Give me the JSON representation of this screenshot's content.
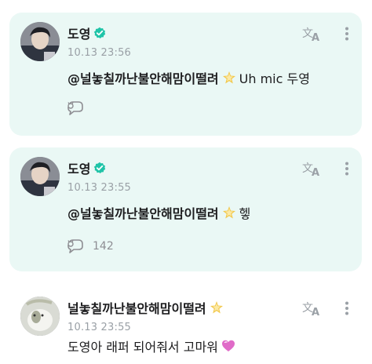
{
  "posts": [
    {
      "author": "도영",
      "time": "10.13 23:56",
      "mention": "@널놓칠까난불안해맘이떨려",
      "text": "Uh mic 두영",
      "reply_count": ""
    },
    {
      "author": "도영",
      "time": "10.13 23:55",
      "mention": "@널놓칠까난불안해맘이떨려",
      "text": "헿",
      "reply_count": "142"
    },
    {
      "author": "널놓칠까난불안해맘이떨려",
      "time": "10.13 23:55",
      "text": "도영아 래퍼 되어줘서 고마워"
    }
  ],
  "colors": {
    "artist_bubble_bg": "#eaf8f5",
    "verified": "#20c4a8",
    "star": "#f2c84b",
    "heart": "#e06bc8",
    "muted": "#9aa0a6"
  },
  "icons": [
    "verified-badge-icon",
    "sparkle-star-icon",
    "translate-icon",
    "more-vertical-icon",
    "reply-icon",
    "heart-icon"
  ]
}
